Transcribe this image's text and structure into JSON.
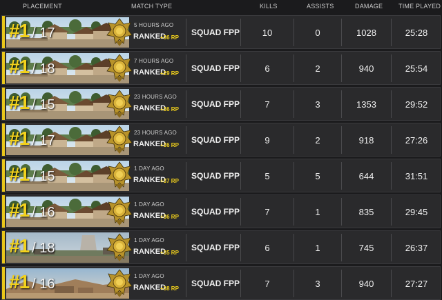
{
  "headers": {
    "placement": "PLACEMENT",
    "match_type": "MATCH TYPE",
    "kills": "KILLS",
    "assists": "ASSISTS",
    "damage": "DAMAGE",
    "time_played": "TIME PLAYED"
  },
  "colors": {
    "accent": "#e9c61a",
    "rp": "#f3d21c",
    "row_bg": "#2a2a2c",
    "page_bg": "#1b1b1d"
  },
  "matches": [
    {
      "rank": "#1",
      "total": "/ 17",
      "when": "5 HOURS AGO",
      "ranked": "RANKED",
      "rp": "+36 RP",
      "mode": "SQUAD FPP",
      "kills": "10",
      "assists": "0",
      "damage": "1028",
      "time": "25:28",
      "map": "sanhok"
    },
    {
      "rank": "#1",
      "total": "/ 18",
      "when": "7 HOURS AGO",
      "ranked": "RANKED",
      "rp": "+29 RP",
      "mode": "SQUAD FPP",
      "kills": "6",
      "assists": "2",
      "damage": "940",
      "time": "25:54",
      "map": "sanhok"
    },
    {
      "rank": "#1",
      "total": "/ 15",
      "when": "23 HOURS AGO",
      "ranked": "RANKED",
      "rp": "+36 RP",
      "mode": "SQUAD FPP",
      "kills": "7",
      "assists": "3",
      "damage": "1353",
      "time": "29:52",
      "map": "sanhok"
    },
    {
      "rank": "#1",
      "total": "/ 17",
      "when": "23 HOURS AGO",
      "ranked": "RANKED",
      "rp": "+36 RP",
      "mode": "SQUAD FPP",
      "kills": "9",
      "assists": "2",
      "damage": "918",
      "time": "27:26",
      "map": "sanhok"
    },
    {
      "rank": "#1",
      "total": "/ 15",
      "when": "1 DAY AGO",
      "ranked": "RANKED",
      "rp": "+37 RP",
      "mode": "SQUAD FPP",
      "kills": "5",
      "assists": "5",
      "damage": "644",
      "time": "31:51",
      "map": "sanhok"
    },
    {
      "rank": "#1",
      "total": "/ 16",
      "when": "1 DAY AGO",
      "ranked": "RANKED",
      "rp": "+36 RP",
      "mode": "SQUAD FPP",
      "kills": "7",
      "assists": "1",
      "damage": "835",
      "time": "29:45",
      "map": "sanhok"
    },
    {
      "rank": "#1",
      "total": "/ 18",
      "when": "1 DAY AGO",
      "ranked": "RANKED",
      "rp": "+35 RP",
      "mode": "SQUAD FPP",
      "kills": "6",
      "assists": "1",
      "damage": "745",
      "time": "26:37",
      "map": "erangel"
    },
    {
      "rank": "#1",
      "total": "/ 16",
      "when": "1 DAY AGO",
      "ranked": "RANKED",
      "rp": "+38 RP",
      "mode": "SQUAD FPP",
      "kills": "7",
      "assists": "3",
      "damage": "940",
      "time": "27:27",
      "map": "miramar"
    }
  ]
}
